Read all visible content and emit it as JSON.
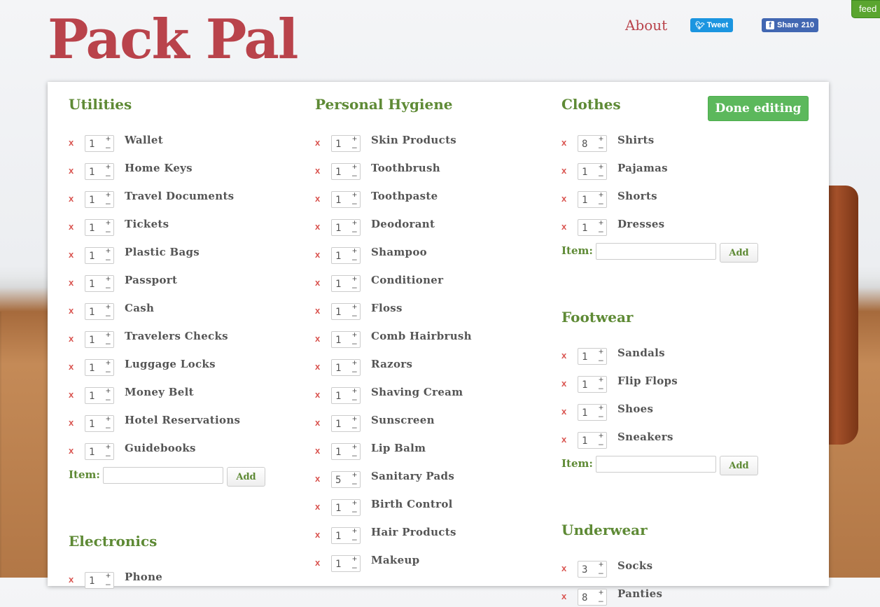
{
  "header": {
    "logo": "Pack Pal",
    "about": "About",
    "tweet": "Tweet",
    "share": "Share",
    "share_count": "210",
    "feedback": "feed"
  },
  "done_label": "Done editing",
  "item_label": "Item:",
  "add_label": "Add",
  "columns": [
    {
      "sections": [
        {
          "title": "Utilities",
          "items": [
            {
              "qty": "1",
              "name": "Wallet"
            },
            {
              "qty": "1",
              "name": "Home Keys"
            },
            {
              "qty": "1",
              "name": "Travel Documents"
            },
            {
              "qty": "1",
              "name": "Tickets"
            },
            {
              "qty": "1",
              "name": "Plastic Bags"
            },
            {
              "qty": "1",
              "name": "Passport"
            },
            {
              "qty": "1",
              "name": "Cash"
            },
            {
              "qty": "1",
              "name": "Travelers Checks"
            },
            {
              "qty": "1",
              "name": "Luggage Locks"
            },
            {
              "qty": "1",
              "name": "Money Belt"
            },
            {
              "qty": "1",
              "name": "Hotel Reservations"
            },
            {
              "qty": "1",
              "name": "Guidebooks"
            }
          ],
          "show_add": true
        },
        {
          "title": "Electronics",
          "items": [
            {
              "qty": "1",
              "name": "Phone"
            }
          ],
          "show_add": false
        }
      ]
    },
    {
      "sections": [
        {
          "title": "Personal Hygiene",
          "items": [
            {
              "qty": "1",
              "name": "Skin Products"
            },
            {
              "qty": "1",
              "name": "Toothbrush"
            },
            {
              "qty": "1",
              "name": "Toothpaste"
            },
            {
              "qty": "1",
              "name": "Deodorant"
            },
            {
              "qty": "1",
              "name": "Shampoo"
            },
            {
              "qty": "1",
              "name": "Conditioner"
            },
            {
              "qty": "1",
              "name": "Floss"
            },
            {
              "qty": "1",
              "name": "Comb Hairbrush"
            },
            {
              "qty": "1",
              "name": "Razors"
            },
            {
              "qty": "1",
              "name": "Shaving Cream"
            },
            {
              "qty": "1",
              "name": "Sunscreen"
            },
            {
              "qty": "1",
              "name": "Lip Balm"
            },
            {
              "qty": "5",
              "name": "Sanitary Pads"
            },
            {
              "qty": "1",
              "name": "Birth Control"
            },
            {
              "qty": "1",
              "name": "Hair Products"
            },
            {
              "qty": "1",
              "name": "Makeup"
            }
          ],
          "show_add": false
        }
      ]
    },
    {
      "sections": [
        {
          "title": "Clothes",
          "items": [
            {
              "qty": "8",
              "name": "Shirts"
            },
            {
              "qty": "1",
              "name": "Pajamas"
            },
            {
              "qty": "1",
              "name": "Shorts"
            },
            {
              "qty": "1",
              "name": "Dresses"
            }
          ],
          "show_add": true
        },
        {
          "title": "Footwear",
          "items": [
            {
              "qty": "1",
              "name": "Sandals"
            },
            {
              "qty": "1",
              "name": "Flip Flops"
            },
            {
              "qty": "1",
              "name": "Shoes"
            },
            {
              "qty": "1",
              "name": "Sneakers"
            }
          ],
          "show_add": true
        },
        {
          "title": "Underwear",
          "items": [
            {
              "qty": "3",
              "name": "Socks"
            },
            {
              "qty": "8",
              "name": "Panties"
            }
          ],
          "show_add": false
        }
      ]
    }
  ]
}
